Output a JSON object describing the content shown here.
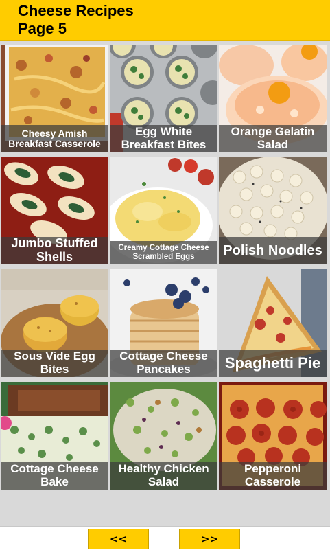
{
  "header": {
    "title_line1": "Cheese Recipes",
    "title_line2": "Page 5"
  },
  "recipes": [
    {
      "name": "Cheesy Amish Breakfast Casserole",
      "line1": "Cheesy Amish",
      "line2": "Breakfast Casserole"
    },
    {
      "name": "Egg White Breakfast Bites",
      "line1": "Egg White",
      "line2": "Breakfast Bites"
    },
    {
      "name": "Orange Gelatin Salad",
      "line1": "Orange Gelatin",
      "line2": "Salad"
    },
    {
      "name": "Jumbo Stuffed Shells",
      "line1": "Jumbo Stuffed",
      "line2": "Shells"
    },
    {
      "name": "Creamy Cottage Cheese Scrambled Eggs",
      "line1": "Creamy Cottage Cheese",
      "line2": "Scrambled Eggs"
    },
    {
      "name": "Polish Noodles",
      "line1": "Polish Noodles",
      "line2": ""
    },
    {
      "name": "Sous Vide Egg Bites",
      "line1": "Sous Vide Egg",
      "line2": "Bites"
    },
    {
      "name": "Cottage Cheese Pancakes",
      "line1": "Cottage Cheese",
      "line2": "Pancakes"
    },
    {
      "name": "Spaghetti Pie",
      "line1": "Spaghetti Pie",
      "line2": ""
    },
    {
      "name": "Cottage Cheese Bake",
      "line1": "Cottage Cheese",
      "line2": "Bake"
    },
    {
      "name": "Healthy Chicken Salad",
      "line1": "Healthy Chicken",
      "line2": "Salad"
    },
    {
      "name": "Pepperoni Casserole",
      "line1": "Pepperoni",
      "line2": "Casserole"
    }
  ],
  "footer": {
    "prev_label": "<<",
    "next_label": ">>"
  },
  "colors": {
    "accent": "#ffcc00",
    "grid_background": "#d9d9d9",
    "caption_overlay": "#3c3c3c"
  }
}
